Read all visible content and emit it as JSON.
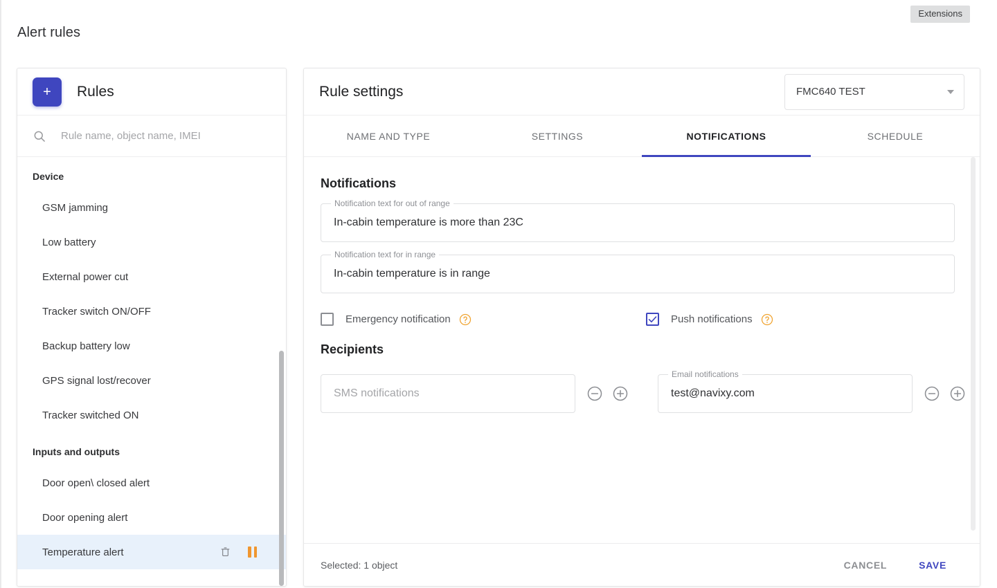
{
  "top": {
    "extensions_chip": "Extensions",
    "page_title": "Alert rules"
  },
  "rules_panel": {
    "add_label": "+",
    "title": "Rules",
    "search": {
      "placeholder": "Rule name, object name, IMEI",
      "value": "",
      "icon": "search-icon"
    },
    "groups": [
      {
        "label": "Device",
        "items": [
          {
            "label": "GSM jamming",
            "selected": false
          },
          {
            "label": "Low battery",
            "selected": false
          },
          {
            "label": "External power cut",
            "selected": false
          },
          {
            "label": "Tracker switch ON/OFF",
            "selected": false
          },
          {
            "label": "Backup battery low",
            "selected": false
          },
          {
            "label": "GPS signal lost/recover",
            "selected": false
          },
          {
            "label": "Tracker switched ON",
            "selected": false
          }
        ]
      },
      {
        "label": "Inputs and outputs",
        "items": [
          {
            "label": "Door open\\ closed alert",
            "selected": false
          },
          {
            "label": "Door opening alert",
            "selected": false
          },
          {
            "label": "Temperature alert",
            "selected": true
          }
        ]
      }
    ],
    "row_actions": {
      "delete_icon": "trash-icon",
      "pause_icon": "pause-icon"
    }
  },
  "settings_panel": {
    "title": "Rule settings",
    "object_select": {
      "value": "FMC640 TEST",
      "caret_icon": "chevron-down-icon"
    },
    "tabs": [
      {
        "label": "NAME AND TYPE",
        "active": false
      },
      {
        "label": "SETTINGS",
        "active": false
      },
      {
        "label": "NOTIFICATIONS",
        "active": true
      },
      {
        "label": "SCHEDULE",
        "active": false
      }
    ],
    "notifications": {
      "heading": "Notifications",
      "out_of_range": {
        "label": "Notification text for out of range",
        "value": "In-cabin temperature is more than 23C"
      },
      "in_range": {
        "label": "Notification text for in range",
        "value": "In-cabin temperature is in range"
      },
      "emergency": {
        "label": "Emergency notification",
        "checked": false,
        "help_icon": "help-circle-icon"
      },
      "push": {
        "label": "Push notifications",
        "checked": true,
        "help_icon": "help-circle-icon"
      }
    },
    "recipients": {
      "heading": "Recipients",
      "sms": {
        "label": "",
        "placeholder": "SMS notifications",
        "value": "",
        "remove_icon": "minus-circle-icon",
        "add_icon": "plus-circle-icon"
      },
      "email": {
        "label": "Email notifications",
        "placeholder": "",
        "value": "test@navixy.com",
        "remove_icon": "minus-circle-icon",
        "add_icon": "plus-circle-icon"
      }
    },
    "footer": {
      "selected_text": "Selected: 1 object",
      "cancel_label": "CANCEL",
      "save_label": "SAVE"
    }
  },
  "colors": {
    "accent": "#3f46bf",
    "warning": "#f0962f",
    "selected_row": "#e8f1fb"
  }
}
